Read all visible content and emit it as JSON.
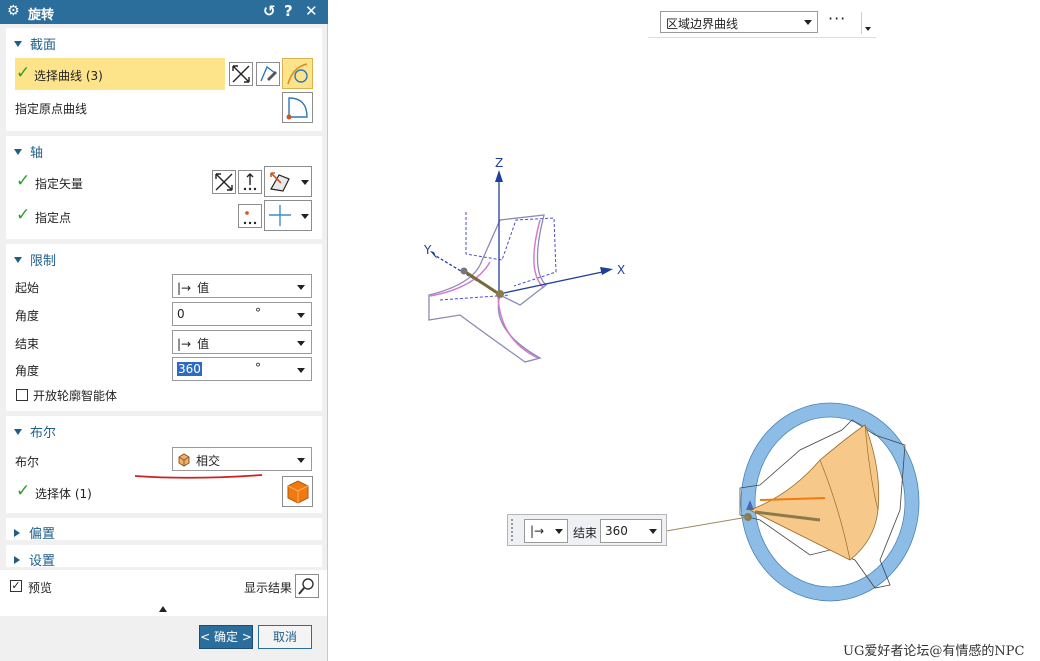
{
  "dialog": {
    "title": "旋转",
    "reset_glyph": "↺",
    "help_glyph": "?",
    "close_glyph": "✕",
    "section_label": {
      "label": "截面",
      "select_curve": "选择曲线 (3)",
      "specify_origin_curve": "指定原点曲线"
    },
    "section_axis": {
      "label": "轴",
      "specify_vector": "指定矢量",
      "specify_point": "指定点"
    },
    "section_limits": {
      "label": "限制",
      "start_label": "起始",
      "start_value": "值",
      "start_angle_label": "角度",
      "start_angle": "0",
      "end_label": "结束",
      "end_value": "值",
      "end_angle_label": "角度",
      "end_angle": "360",
      "unit": "°",
      "open_profile": "开放轮廓智能体"
    },
    "section_boolean": {
      "label": "布尔",
      "boolean_label": "布尔",
      "boolean_value": "相交",
      "select_body": "选择体 (1)"
    },
    "section_offset": {
      "label": "偏置"
    },
    "section_settings": {
      "label": "设置"
    },
    "preview_label": "预览",
    "show_result_label": "显示结果",
    "ok_label": "< 确定 >",
    "cancel_label": "取消"
  },
  "toolbar": {
    "filter_value": "区域边界曲线",
    "more_glyph": "···"
  },
  "viewport": {
    "axis_z": "Z",
    "axis_y": "Y",
    "axis_x": "X"
  },
  "float_input": {
    "end_label": "结束",
    "end_value": "360"
  },
  "watermark": "UG爱好者论坛@有情感的NPC",
  "colors": {
    "title_bar": "#2c6e9b",
    "section_head": "#1d5e8a",
    "highlight_row": "#fde38a",
    "check_green": "#2aa02a",
    "revolve_body": "#f6c98a",
    "ring": "#8dbde6"
  }
}
